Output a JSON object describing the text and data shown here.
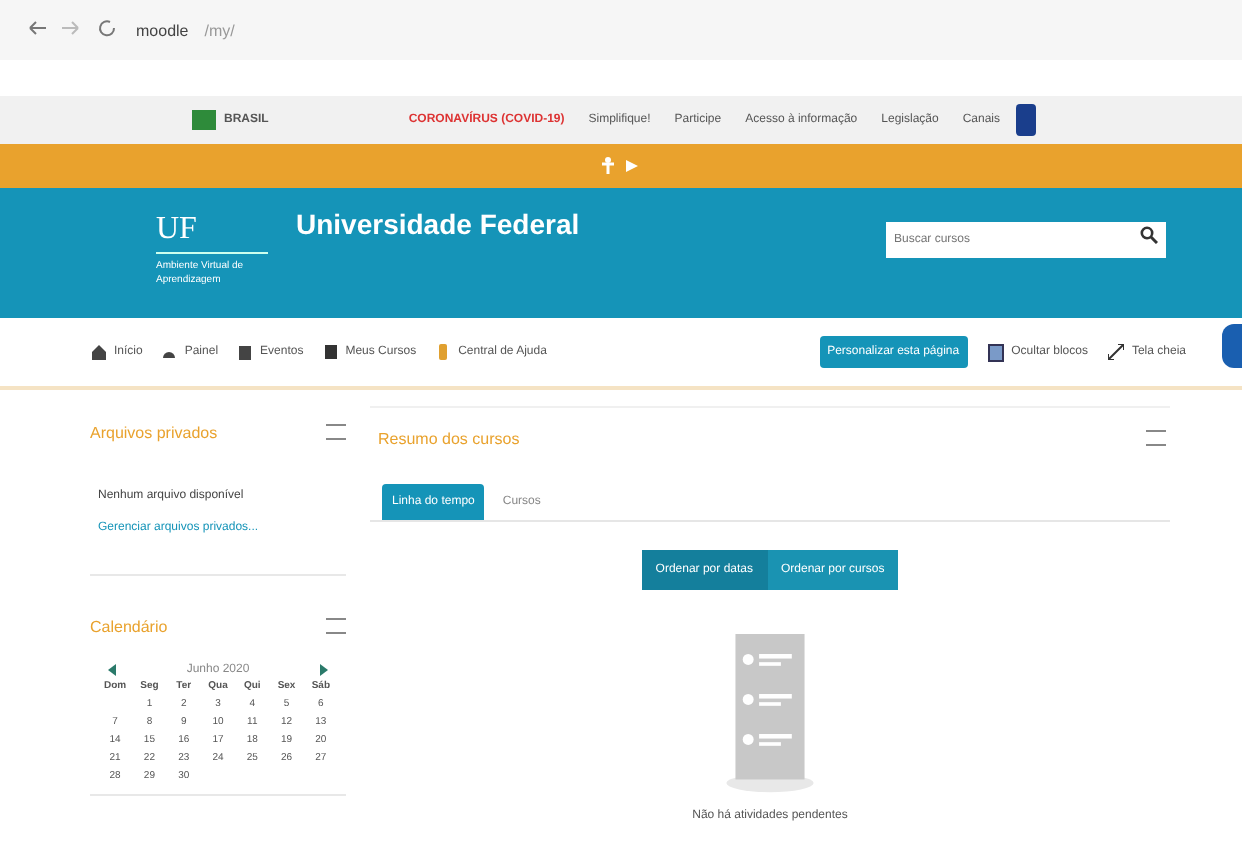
{
  "browser": {
    "site": "moodle",
    "url": "/my/"
  },
  "gov_bar": {
    "brand": "BRASIL",
    "links": [
      {
        "label": "CORONAVÍRUS (COVID-19)",
        "kind": "alert"
      },
      {
        "label": "Simplifique!",
        "kind": "normal"
      },
      {
        "label": "Participe",
        "kind": "normal"
      },
      {
        "label": "Acesso à informação",
        "kind": "normal"
      },
      {
        "label": "Legislação",
        "kind": "normal"
      },
      {
        "label": "Canais",
        "kind": "normal"
      }
    ]
  },
  "header": {
    "logo": "UF",
    "logo_subtitle": "Ambiente Virtual de Aprendizagem",
    "title": "Universidade Federal",
    "search": {
      "placeholder": "Buscar cursos"
    }
  },
  "nav": {
    "items": [
      "Início",
      "Painel",
      "Eventos",
      "Meus Cursos",
      "Central de Ajuda"
    ],
    "customize": "Personalizar esta página",
    "hide_blocks": "Ocultar blocos",
    "fullscreen": "Tela cheia"
  },
  "private_files": {
    "title": "Arquivos privados",
    "empty": "Nenhum arquivo disponível",
    "manage": "Gerenciar arquivos privados..."
  },
  "calendar": {
    "title": "Calendário",
    "month": "Junho 2020",
    "weekdays": [
      "Dom",
      "Seg",
      "Ter",
      "Qua",
      "Qui",
      "Sex",
      "Sáb"
    ],
    "weeks": [
      {
        "kind": "first",
        "days": [
          "1",
          "2",
          "3",
          "4",
          "5",
          "6"
        ]
      },
      {
        "kind": "middle",
        "days": [
          "7",
          "8",
          "9",
          "10",
          "11",
          "12",
          "13"
        ]
      },
      {
        "kind": "middle",
        "days": [
          "14",
          "15",
          "16",
          "17",
          "18",
          "19",
          "20"
        ]
      },
      {
        "kind": "middle",
        "days": [
          "21",
          "22",
          "23",
          "24",
          "25",
          "26",
          "27"
        ]
      },
      {
        "kind": "last",
        "days": [
          "28",
          "29",
          "30"
        ]
      }
    ]
  },
  "overview": {
    "title": "Resumo dos cursos",
    "tabs": [
      {
        "label": "Linha do tempo",
        "selected": true
      },
      {
        "label": "Cursos",
        "selected": false
      }
    ],
    "sort_buttons": [
      {
        "label": "Ordenar por datas",
        "selected": true
      },
      {
        "label": "Ordenar por cursos",
        "selected": false
      }
    ],
    "empty": "Não há atividades pendentes"
  }
}
